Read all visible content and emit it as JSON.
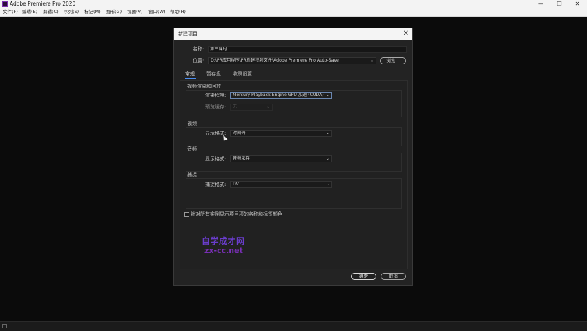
{
  "app": {
    "title": "Adobe Premiere Pro 2020",
    "window_controls": {
      "minimize": "—",
      "maximize": "❐",
      "close": "✕"
    }
  },
  "menubar": {
    "items": [
      "文件(F)",
      "编辑(E)",
      "剪辑(C)",
      "序列(S)",
      "标记(M)",
      "图形(G)",
      "视图(V)",
      "窗口(W)",
      "帮助(H)"
    ]
  },
  "dialog": {
    "title": "新建项目",
    "close_glyph": "✕",
    "name_label": "名称:",
    "name_value": "第三课时",
    "location_label": "位置:",
    "location_value": "D:\\PR应用程序\\PR新建视频文件\\Adobe Premiere Pro Auto-Save",
    "browse_label": "浏览...",
    "tabs": [
      "常规",
      "暂存盘",
      "收录设置"
    ],
    "active_tab": "常规",
    "groups": {
      "render": {
        "title": "视频渲染和回放",
        "renderer_label": "渲染程序:",
        "renderer_value": "Mercury Playback Engine GPU 加速 (CUDA)",
        "preview_cache_label": "预览缓存:",
        "preview_cache_value": "无"
      },
      "video": {
        "title": "视频",
        "display_format_label": "显示格式:",
        "display_format_value": "时间码"
      },
      "audio": {
        "title": "音频",
        "display_format_label": "显示格式:",
        "display_format_value": "音频采样"
      },
      "capture": {
        "title": "捕捉",
        "capture_format_label": "捕捉格式:",
        "capture_format_value": "DV"
      }
    },
    "checkbox_label": "针对所有实例显示项目项的名称和标签颜色",
    "checkbox_checked": false,
    "ok_label": "确定",
    "cancel_label": "取消"
  },
  "watermark": {
    "line1": "自学成才网",
    "line2": "zx-cc.net"
  },
  "icons": {
    "chevron_down": "⌄"
  }
}
